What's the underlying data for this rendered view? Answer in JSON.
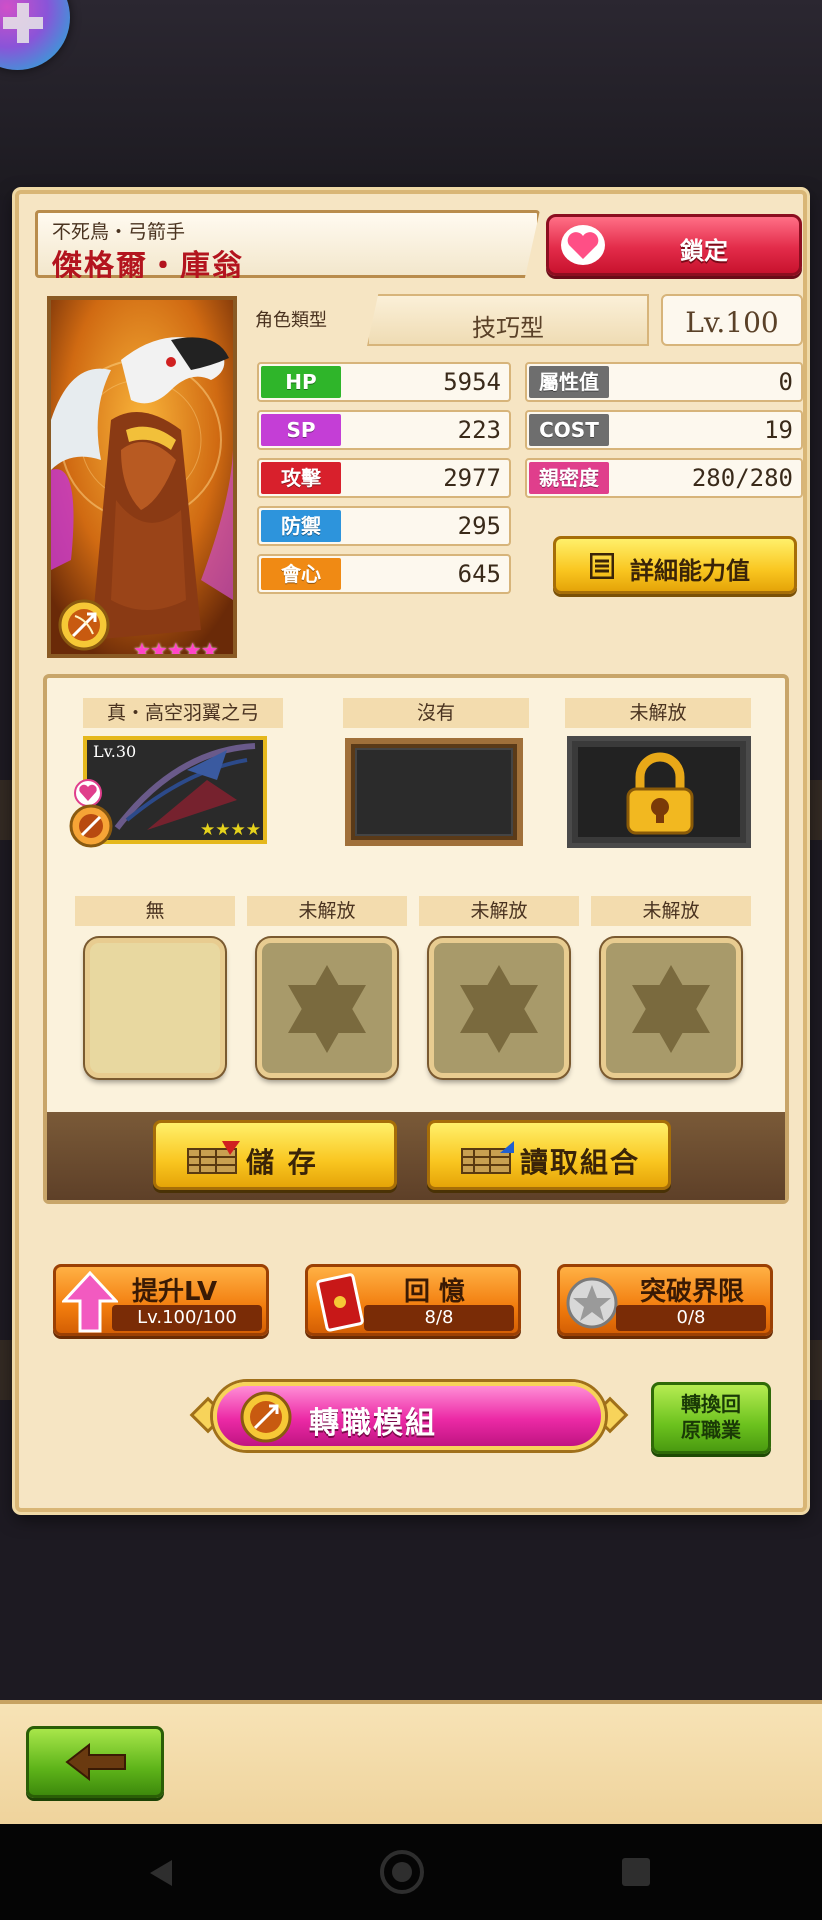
{
  "header": {
    "class_label": "不死鳥・弓箭手",
    "name": "傑格爾・庫翁",
    "lock_label": "鎖定"
  },
  "profile": {
    "stars": "★★★★★",
    "role_label": "角色類型",
    "role_value": "技巧型",
    "level": "Lv.100"
  },
  "stats": {
    "hp": {
      "label": "HP",
      "value": "5954",
      "color": "#2fb52a"
    },
    "sp": {
      "label": "SP",
      "value": "223",
      "color": "#c43ed6"
    },
    "atk": {
      "label": "攻擊",
      "value": "2977",
      "color": "#d8202c"
    },
    "def": {
      "label": "防禦",
      "value": "295",
      "color": "#2d94dc"
    },
    "crit": {
      "label": "會心",
      "value": "645",
      "color": "#f08a14"
    },
    "attr": {
      "label": "屬性值",
      "value": "0",
      "color": "#6e6e6e"
    },
    "cost": {
      "label": "COST",
      "value": "19",
      "color": "#6e6e6e"
    },
    "intimacy": {
      "label": "親密度",
      "value": "280/280",
      "color": "#e03e8c"
    }
  },
  "detail_button": "詳細能力值",
  "equipment": {
    "weapon_slots": [
      {
        "label": "真・高空羽翼之弓",
        "level": "Lv.30",
        "stars": "★★★★"
      },
      {
        "label": "沒有"
      },
      {
        "label": "未解放"
      }
    ],
    "gem_slots": [
      {
        "label": "無"
      },
      {
        "label": "未解放"
      },
      {
        "label": "未解放"
      },
      {
        "label": "未解放"
      }
    ],
    "save_label": "儲 存",
    "load_label": "讀取組合"
  },
  "actions": {
    "level_up": {
      "title": "提升LV",
      "sub": "Lv.100/100"
    },
    "memory": {
      "title": "回 憶",
      "sub": "8/8"
    },
    "limit_break": {
      "title": "突破界限",
      "sub": "0/8"
    },
    "job_change": "轉職模組",
    "revert_job": "轉換回\n原職業"
  }
}
